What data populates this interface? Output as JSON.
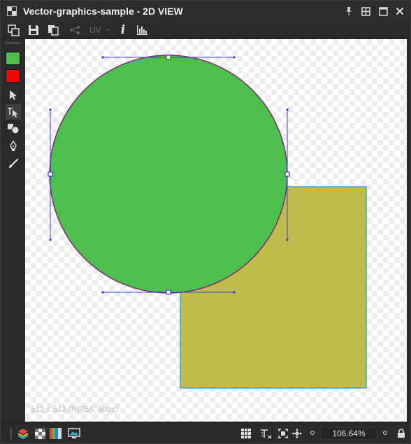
{
  "window": {
    "title": "Vector-graphics-sample - 2D VIEW"
  },
  "toolbar": {
    "uv_label": "UV",
    "uv_chevron": "⌄",
    "info_glyph": "i"
  },
  "tools": {
    "foreground_color": "#4cbf4c",
    "background_color": "#ff0000"
  },
  "canvas": {
    "image_info": "512 x 512 (RGBA, 8bpc)",
    "shapes": {
      "circle_fill": "#4cbf4c",
      "circle_stroke": "#7b2f6e",
      "square_fill": "#c0bc4c",
      "square_stroke": "#3fa6d8",
      "handle_color": "#3b3bd9"
    }
  },
  "statusbar": {
    "zoom": "106.64%"
  },
  "icons": {
    "app": "view-2d-icon",
    "pin": "pin-icon",
    "tile": "tile-layout-icon",
    "maximize": "maximize-icon",
    "close": "close-icon",
    "new": "new-document-icon",
    "save": "save-icon",
    "copy": "copy-icon",
    "share": "share-icon",
    "histogram": "histogram-icon",
    "layers": "layers-icon",
    "checker": "transparency-icon",
    "channels": "channels-icon",
    "display": "display-icon",
    "grid": "grid-icon",
    "text_tool": "text-snap-icon",
    "fit": "fit-view-icon",
    "pan": "pan-icon",
    "lock": "lock-icon"
  }
}
